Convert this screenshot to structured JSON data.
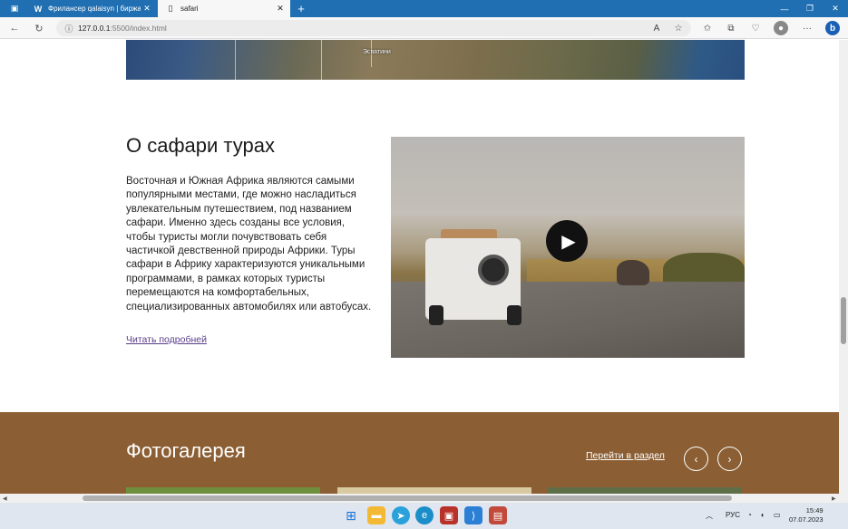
{
  "browser": {
    "tabs": [
      {
        "icon": "W",
        "label": "Фрилансер qalaisyn | биржа фр",
        "active": false
      },
      {
        "icon": "page",
        "label": "safari",
        "active": true
      }
    ],
    "url_host": "127.0.0.1",
    "url_path": ":5500/index.html",
    "new_tab": "+"
  },
  "page": {
    "map_label": "Эсватини",
    "about": {
      "title": "О сафари турах",
      "text": "Восточная и Южная Африка являются самыми популярными местами, где можно насладиться увлекательным путешествием, под названием сафари. Именно здесь созданы все условия, чтобы туристы могли почувствовать себя частичкой девственной природы Африки. Туры сафари в Африку характеризуются уникальными программами, в рамках которых туристы перемещаются на комфортабельных, специализированных автомобилях или автобусах.",
      "link": "Читать подробней"
    },
    "gallery": {
      "title": "Фотогалерея",
      "link": "Перейти в раздел",
      "prev": "‹",
      "next": "›"
    }
  },
  "taskbar": {
    "lang": "РУС",
    "time": "15:49",
    "date": "07.07.2023"
  },
  "colors": {
    "tabbar": "#1f6fb2",
    "gallery_bg": "#8b5e33"
  }
}
